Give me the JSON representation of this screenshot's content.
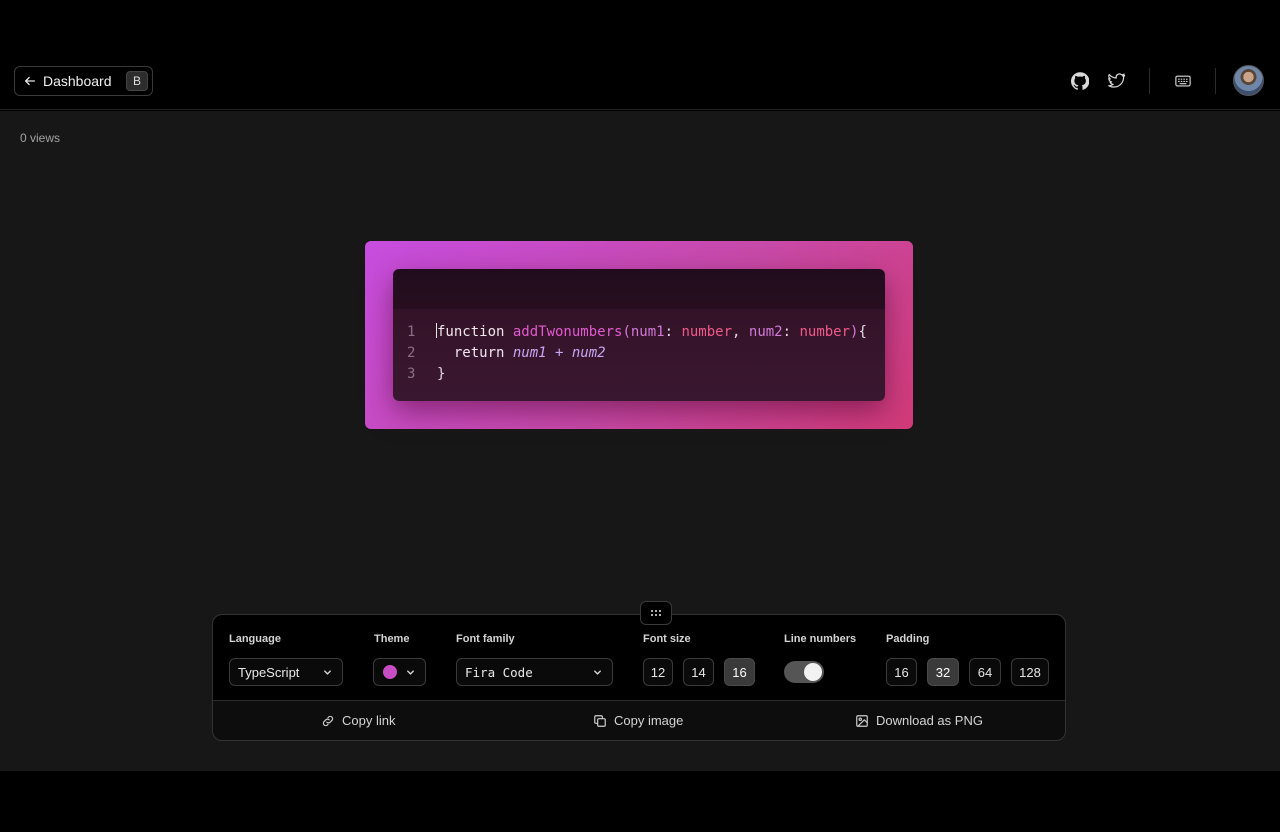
{
  "header": {
    "back_label": "Dashboard",
    "back_shortcut": "B",
    "icons": [
      "github-icon",
      "twitter-icon",
      "keyboard-icon"
    ]
  },
  "main": {
    "views_text": "0 views"
  },
  "code": {
    "language": "TypeScript",
    "lines": [
      {
        "n": "1",
        "tokens": [
          [
            "kw",
            "function "
          ],
          [
            "fn",
            "addTwonumbers"
          ],
          [
            "par",
            "("
          ],
          [
            "par",
            "num1"
          ],
          [
            "punct",
            ": "
          ],
          [
            "type",
            "number"
          ],
          [
            "punct",
            ", "
          ],
          [
            "par",
            "num2"
          ],
          [
            "punct",
            ": "
          ],
          [
            "type",
            "number"
          ],
          [
            "par",
            ")"
          ],
          [
            "punct",
            "{"
          ]
        ]
      },
      {
        "n": "2",
        "tokens": [
          [
            "kw",
            "  return "
          ],
          [
            "ital",
            "num1"
          ],
          [
            "ital",
            " + "
          ],
          [
            "ital",
            "num2"
          ]
        ]
      },
      {
        "n": "3",
        "tokens": [
          [
            "punct",
            "}"
          ]
        ]
      }
    ],
    "gradient_colors": [
      "#c74de0",
      "#d23a78"
    ]
  },
  "toolbar": {
    "language_label": "Language",
    "language_value": "TypeScript",
    "theme_label": "Theme",
    "theme_color": "#c74dc4",
    "font_family_label": "Font family",
    "font_family_value": "Fira Code",
    "font_size_label": "Font size",
    "font_sizes": [
      "12",
      "14",
      "16"
    ],
    "font_size_selected": "16",
    "line_numbers_label": "Line numbers",
    "line_numbers_on": true,
    "padding_label": "Padding",
    "paddings": [
      "16",
      "32",
      "64",
      "128"
    ],
    "padding_selected": "32",
    "copy_link": "Copy link",
    "copy_image": "Copy image",
    "download_png": "Download as PNG"
  }
}
